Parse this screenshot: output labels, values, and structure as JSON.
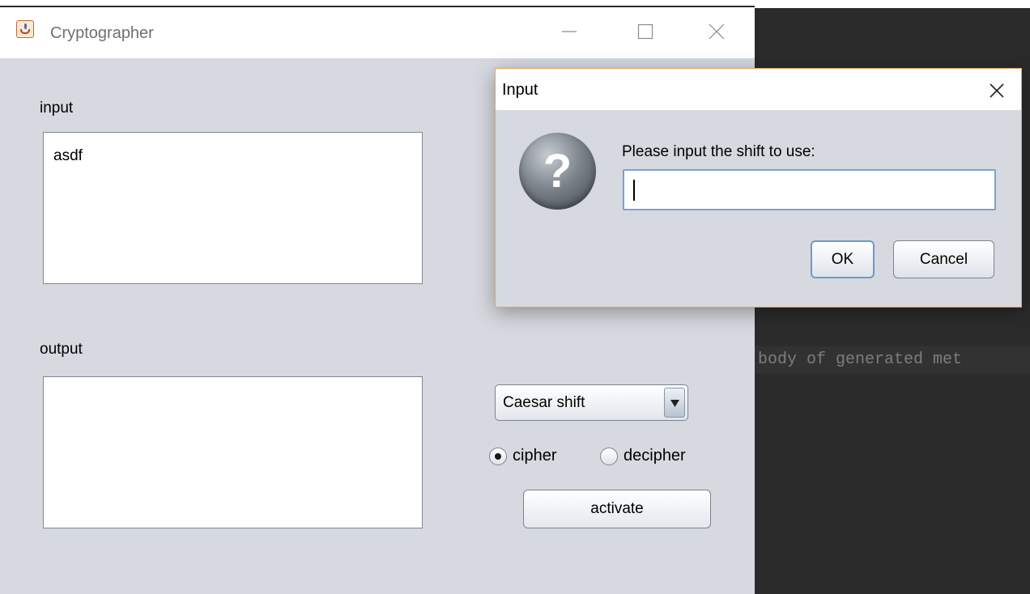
{
  "background_editor": {
    "code_snippet": "body of generated met"
  },
  "main_window": {
    "title": "Cryptographer",
    "input_label": "input",
    "input_text": "asdf",
    "output_label": "output",
    "output_text": "",
    "cipher_select": {
      "selected": "Caesar shift"
    },
    "mode_options": [
      {
        "label": "cipher",
        "selected": true
      },
      {
        "label": "decipher",
        "selected": false
      }
    ],
    "activate_label": "activate"
  },
  "dialog": {
    "title": "Input",
    "icon": "question-icon",
    "icon_glyph": "?",
    "message": "Please input the shift to use:",
    "input_value": "",
    "ok_label": "OK",
    "cancel_label": "Cancel"
  },
  "colors": {
    "window_background": "#d6d9df",
    "dialog_border_accent": "#e3a45c",
    "focused_field_border": "#7da2ce",
    "ide_background": "#2b2b2b"
  }
}
